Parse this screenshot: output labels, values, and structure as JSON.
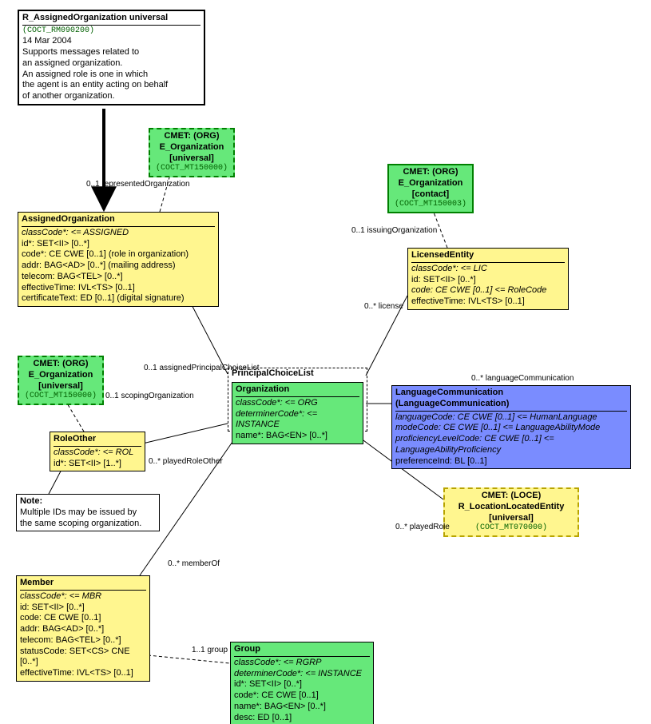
{
  "entry": {
    "title": "R_AssignedOrganization universal",
    "id": "(COCT_RM090200)",
    "date": "14 Mar 2004",
    "desc1": "Supports messages related to",
    "desc2": "an assigned organization.",
    "desc3": "An assigned role is one in which",
    "desc4": "the agent is an entity acting on behalf",
    "desc5": "of another organization."
  },
  "cmet_eorg_univ1": {
    "line1": "CMET: (ORG)",
    "line2": "E_Organization",
    "line3": "[universal]",
    "id": "(COCT_MT150000)"
  },
  "cmet_eorg_univ2": {
    "line1": "CMET: (ORG)",
    "line2": "E_Organization",
    "line3": "[universal]",
    "id": "(COCT_MT150000)"
  },
  "cmet_eorg_contact": {
    "line1": "CMET: (ORG)",
    "line2": "E_Organization",
    "line3": "[contact]",
    "id": "(COCT_MT150003)"
  },
  "cmet_loc": {
    "line1": "CMET: (LOCE)",
    "line2": "R_LocationLocatedEntity",
    "line3": "[universal]",
    "id": "(COCT_MT070000)"
  },
  "assignedOrg": {
    "title": "AssignedOrganization",
    "a1": "classCode*: <= ASSIGNED",
    "a2": "id*: SET<II> [0..*]",
    "a3": "code*: CE CWE [0..1] (role in organization)",
    "a4": "addr: BAG<AD> [0..*] (mailing address)",
    "a5": "telecom: BAG<TEL> [0..*]",
    "a6": "effectiveTime: IVL<TS> [0..1]",
    "a7": "certificateText: ED [0..1] (digital signature)"
  },
  "licensedEntity": {
    "title": "LicensedEntity",
    "a1": "classCode*: <= LIC",
    "a2": "id: SET<II> [0..*]",
    "a3": "code: CE CWE [0..1] <= RoleCode",
    "a4": "effectiveTime: IVL<TS> [0..1]"
  },
  "pcl": {
    "title": "PrincipalChoiceList"
  },
  "organization": {
    "title": "Organization",
    "a1": "classCode*: <= ORG",
    "a2": "determinerCode*: <= INSTANCE",
    "a3": "name*: BAG<EN> [0..*]"
  },
  "langComm": {
    "title": "LanguageCommunication",
    "subtitle": "(LanguageCommunication)",
    "a1": "languageCode: CE CWE [0..1] <= HumanLanguage",
    "a2": "modeCode: CE CWE [0..1] <= LanguageAbilityMode",
    "a3": "proficiencyLevelCode: CE CWE [0..1] <= LanguageAbilityProficiency",
    "a4": "preferenceInd: BL [0..1]"
  },
  "roleOther": {
    "title": "RoleOther",
    "a1": "classCode*: <= ROL",
    "a2": "id*: SET<II> [1..*]"
  },
  "note": {
    "title": "Note:",
    "l1": "Multiple IDs may be issued by",
    "l2": "the same scoping organization."
  },
  "member": {
    "title": "Member",
    "a1": "classCode*: <= MBR",
    "a2": "id: SET<II> [0..*]",
    "a3": "code: CE CWE [0..1]",
    "a4": "addr: BAG<AD> [0..*]",
    "a5": "telecom: BAG<TEL> [0..*]",
    "a6": "statusCode: SET<CS> CNE [0..*]",
    "a7": "effectiveTime: IVL<TS> [0..1]"
  },
  "group": {
    "title": "Group",
    "a1": "classCode*: <= RGRP",
    "a2": "determinerCode*: <= INSTANCE",
    "a3": "id*: SET<II> [0..*]",
    "a4": "code*: CE CWE [0..1]",
    "a5": "name*: BAG<EN> [0..*]",
    "a6": "desc: ED [0..1]"
  },
  "labels": {
    "repOrg": "0..1 representedOrganization",
    "issuingOrg": "0..1 issuingOrganization",
    "license": "0..* license",
    "apcl": "0..1 assignedPrincipalChoiceList",
    "langComm": "0..* languageCommunication",
    "scopingOrg": "0..1 scopingOrganization",
    "playedRoleOther": "0..* playedRoleOther",
    "playedRole": "0..* playedRole",
    "memberOf": "0..* memberOf",
    "group": "1..1 group"
  }
}
